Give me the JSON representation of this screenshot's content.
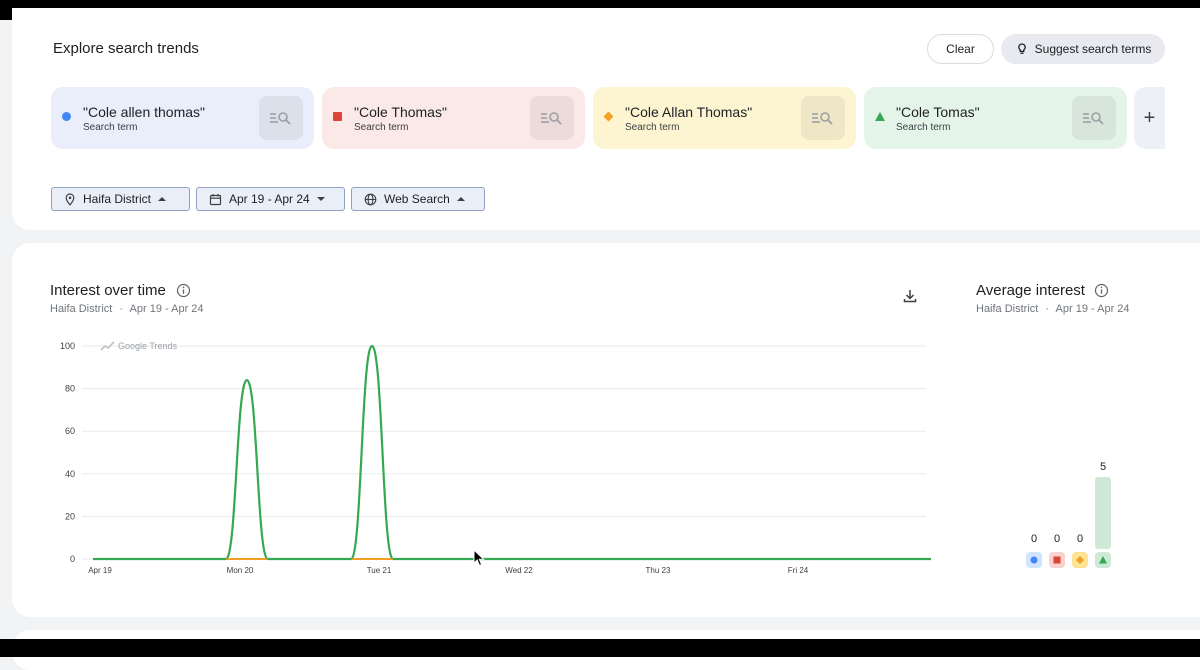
{
  "explore": {
    "title": "Explore search trends",
    "clear_label": "Clear",
    "suggest_label": "Suggest search terms",
    "terms": [
      {
        "name": "\"Cole allen thomas\"",
        "sub": "Search term",
        "color": "#4285f4",
        "bg": "#e9eefa",
        "shape": "circle"
      },
      {
        "name": "\"Cole Thomas\"",
        "sub": "Search term",
        "color": "#db4437",
        "bg": "#fbe9e7",
        "shape": "square"
      },
      {
        "name": "\"Cole Allan Thomas\"",
        "sub": "Search term",
        "color": "#f4a025",
        "bg": "#fdf5d2",
        "shape": "diamond"
      },
      {
        "name": "\"Cole Tomas\"",
        "sub": "Search term",
        "color": "#34a853",
        "bg": "#e5f4e9",
        "shape": "triangle"
      }
    ],
    "filters": {
      "location": "Haifa District",
      "date": "Apr 19 - Apr 24",
      "property": "Web Search"
    }
  },
  "interest": {
    "title": "Interest over time",
    "subtitle_location": "Haifa District",
    "subtitle_date": "Apr 19 - Apr 24",
    "watermark": "Google Trends"
  },
  "average": {
    "title": "Average interest",
    "subtitle_location": "Haifa District",
    "subtitle_date": "Apr 19 - Apr 24"
  },
  "chart_data": [
    {
      "type": "line",
      "x_ticks": [
        "Apr 19",
        "Mon 20",
        "Tue 21",
        "Wed 22",
        "Thu 23",
        "Fri 24"
      ],
      "ylim": [
        0,
        100
      ],
      "y_ticks": [
        0,
        20,
        40,
        60,
        80,
        100
      ],
      "grid": true,
      "series": [
        {
          "name": "\"Cole allen thomas\"",
          "color": "#4285f4",
          "points": [
            [
              0,
              0
            ],
            [
              6,
              0
            ]
          ]
        },
        {
          "name": "\"Cole Thomas\"",
          "color": "#db4437",
          "points": [
            [
              0,
              0
            ],
            [
              6,
              0
            ]
          ]
        },
        {
          "name": "\"Cole Allan Thomas\"",
          "color": "#f4a025",
          "points": [
            [
              0,
              0
            ],
            [
              6,
              0
            ]
          ]
        },
        {
          "name": "\"Cole Tomas\"",
          "color": "#34a853",
          "points": [
            [
              0,
              0
            ],
            [
              0.95,
              0
            ],
            [
              1.1,
              84
            ],
            [
              1.25,
              0
            ],
            [
              1.85,
              0
            ],
            [
              2.0,
              100
            ],
            [
              2.15,
              0
            ],
            [
              6,
              0
            ]
          ]
        }
      ]
    },
    {
      "type": "bar",
      "categories": [
        "\"Cole allen thomas\"",
        "\"Cole Thomas\"",
        "\"Cole Allan Thomas\"",
        "\"Cole Tomas\""
      ],
      "values": [
        0,
        0,
        0,
        5
      ],
      "colors": [
        "#4285f4",
        "#db4437",
        "#f4a025",
        "#34a853"
      ]
    }
  ]
}
